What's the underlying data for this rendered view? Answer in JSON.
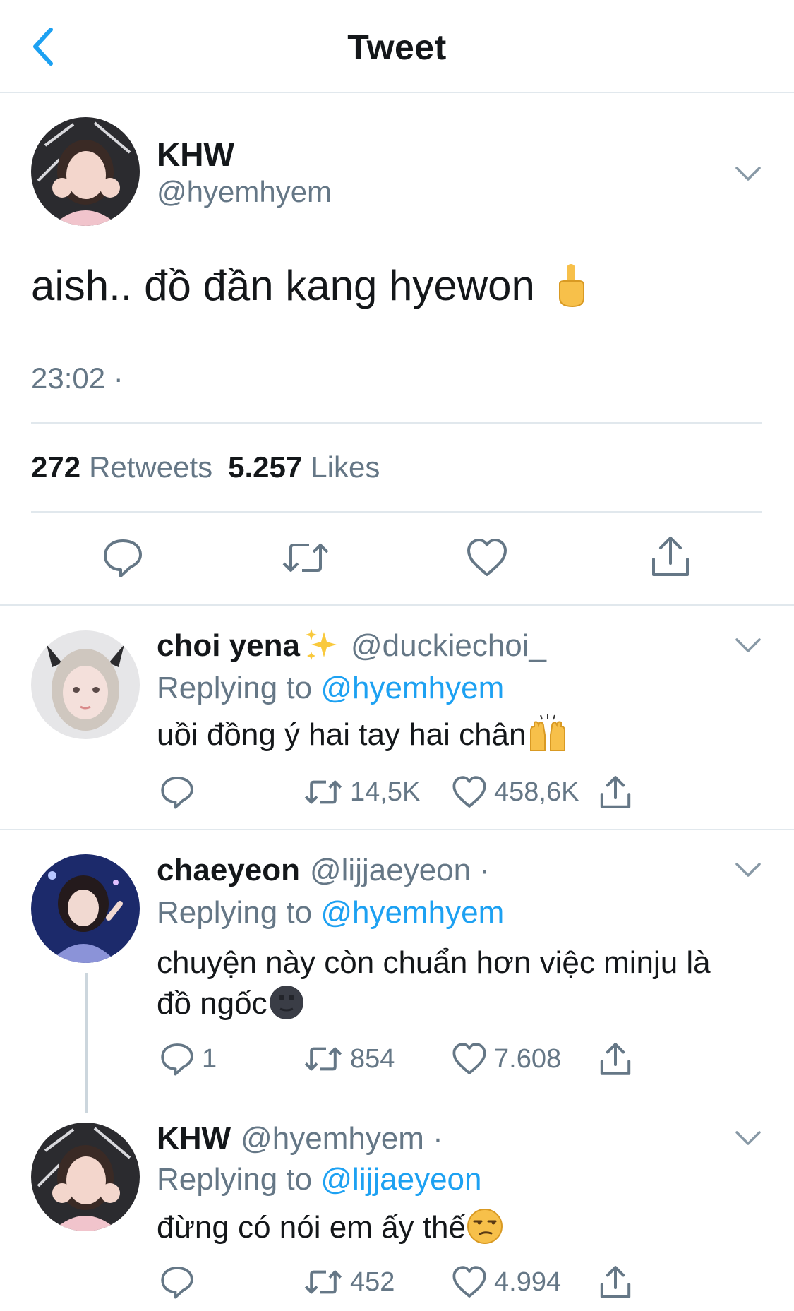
{
  "header": {
    "title": "Tweet",
    "back_icon": "chevron-left-icon",
    "accent": "#1da1f2"
  },
  "main_tweet": {
    "name": "KHW",
    "handle": "@hyemhyem",
    "text": "aish.. đồ đần kang hyewon",
    "emoji": "middle-finger-emoji",
    "time": "23:02 ·",
    "retweets_count": "272",
    "retweets_label": "Retweets",
    "likes_count": "5.257",
    "likes_label": "Likes",
    "actions": [
      "reply-icon",
      "retweet-icon",
      "like-icon",
      "share-icon"
    ]
  },
  "replies": [
    {
      "name": "choi yena",
      "name_emoji": "sparkles-emoji",
      "handle": "@duckiechoi_",
      "replying_prefix": "Replying to",
      "replying_to": "@hyemhyem",
      "text": "uồi đồng ý hai tay hai chân",
      "text_emoji": "raising-hands-emoji",
      "reply_count": "",
      "retweet_count": "14,5K",
      "like_count": "458,6K"
    },
    {
      "name": "chaeyeon",
      "handle": "@lijjaeyeon ·",
      "replying_prefix": "Replying to",
      "replying_to": "@hyemhyem",
      "text_line1": "chuyện này còn chuẩn hơn việc minju là",
      "text_line2": "đồ ngốc",
      "text_emoji": "new-moon-face-emoji",
      "reply_count": "1",
      "retweet_count": "854",
      "like_count": "7.608"
    },
    {
      "name": "KHW",
      "handle": "@hyemhyem ·",
      "replying_prefix": "Replying to",
      "replying_to": "@lijjaeyeon",
      "text": "đừng có nói em ấy thế",
      "text_emoji": "unamused-face-emoji",
      "reply_count": "",
      "retweet_count": "452",
      "like_count": "4.994"
    }
  ]
}
